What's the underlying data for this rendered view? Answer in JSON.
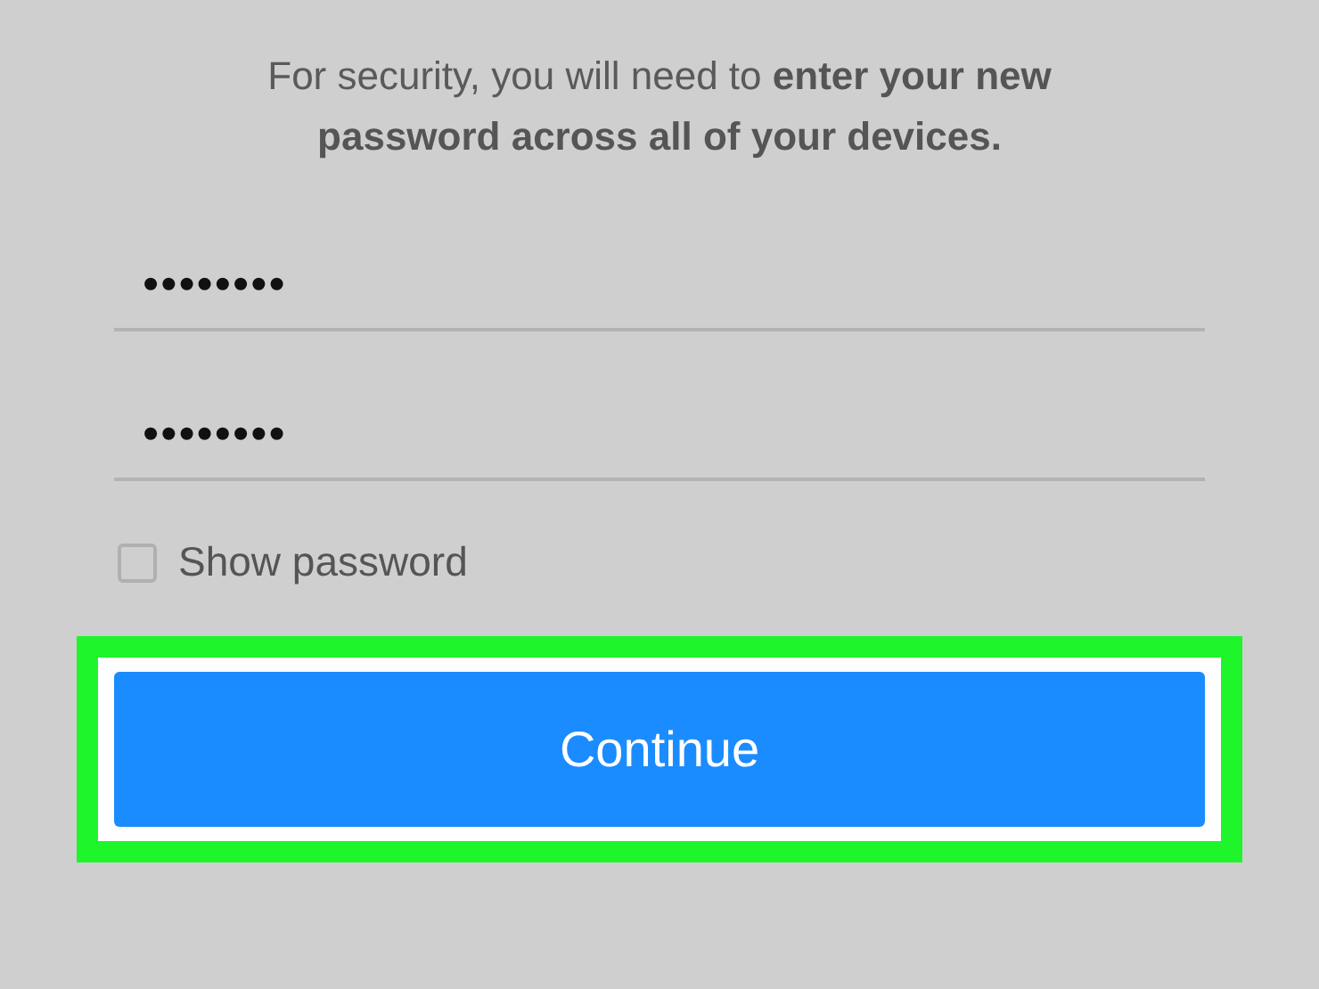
{
  "message": "For security, you will need to **enter your new password across all of your devices.**",
  "password_fields": [
    {
      "value": "••••••••"
    },
    {
      "value": "••••••••"
    }
  ],
  "show_password": {
    "label": "Show password",
    "checked": false
  },
  "continue_button": {
    "label": "Continue",
    "highlighted": true
  }
}
